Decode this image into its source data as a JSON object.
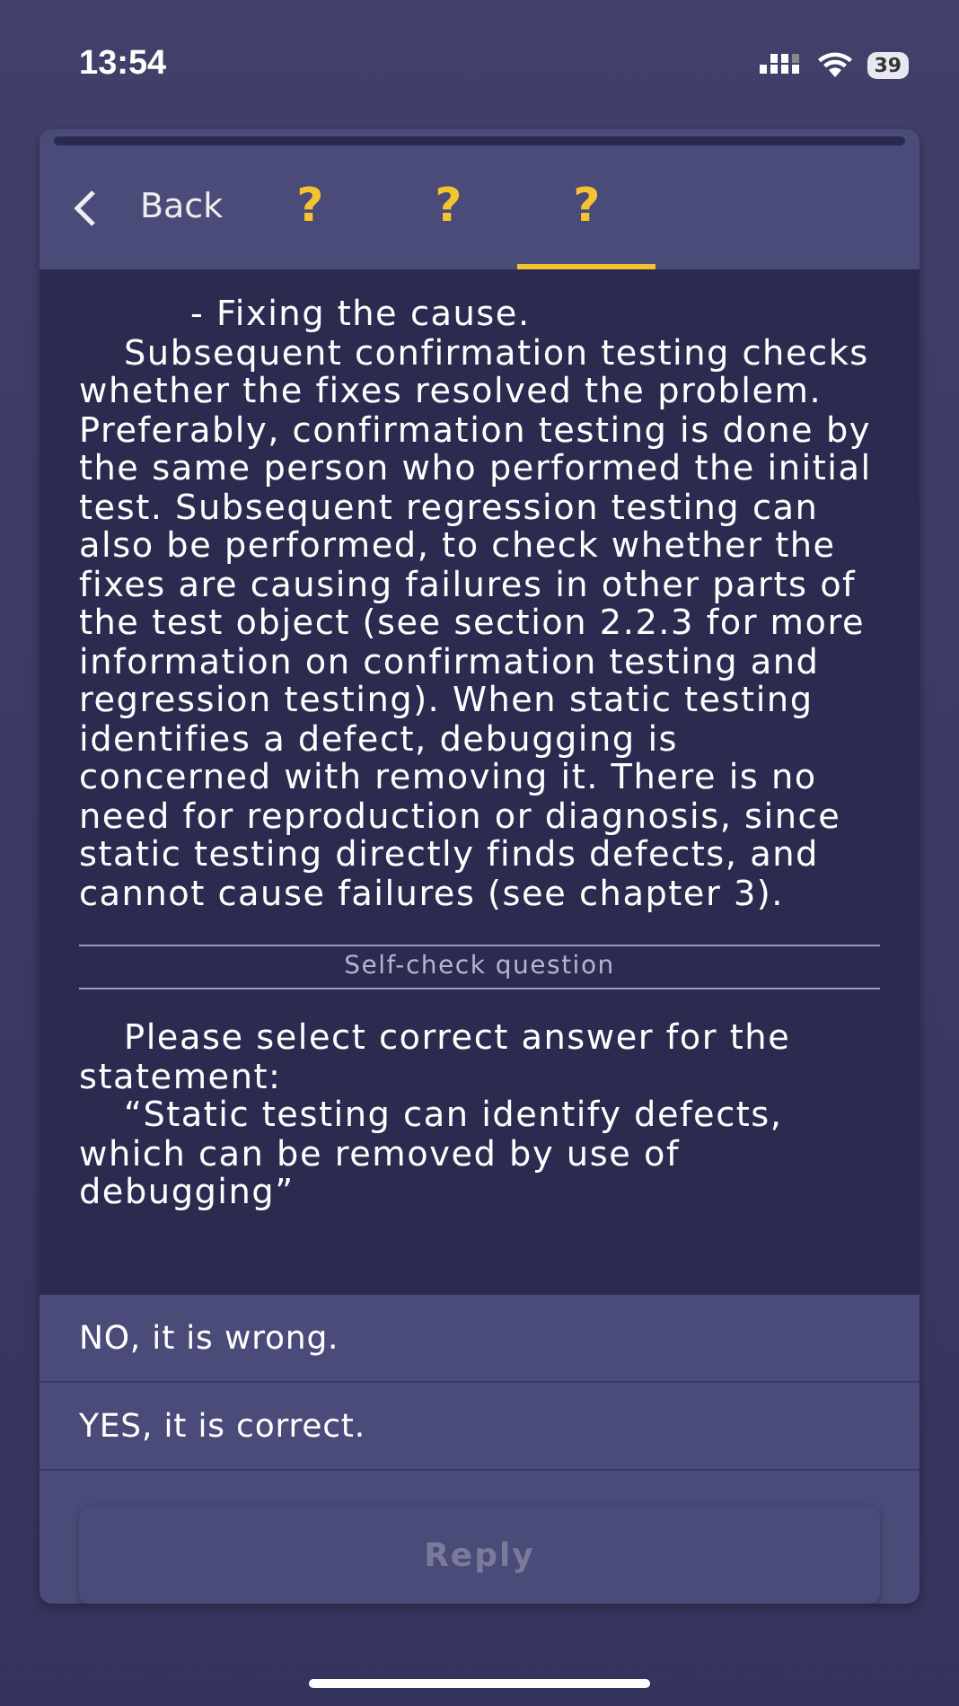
{
  "status_bar": {
    "time": "13:54",
    "battery": "39"
  },
  "header": {
    "back_label": "Back",
    "tabs": [
      {
        "label": "?",
        "selected": false
      },
      {
        "label": "?",
        "selected": false
      },
      {
        "label": "?",
        "selected": true
      }
    ]
  },
  "content": {
    "paragraphs": [
      {
        "text": "- Fixing the cause.",
        "kind": "bullet"
      },
      {
        "text": "Subsequent confirmation testing checks whether the fixes resolved the problem. Preferably, confirmation testing is done by the same person who performed the initial test. Subsequent regression testing can also be performed, to check whether the fixes are causing failures in other parts of the test object (see section 2.2.3 for more information on confirmation testing and regression testing). When static testing identifies a defect, debugging is concerned with removing it. There is no need for reproduction or diagnosis, since static testing directly finds defects, and cannot cause failures (see chapter 3).",
        "kind": "paragraph"
      }
    ],
    "section_title": "Self-check question",
    "question": [
      "Please select correct answer for the statement:",
      "“Static testing can identify defects, which can be removed by use of debugging”"
    ]
  },
  "answers": [
    {
      "text": "NO, it is wrong.",
      "selected": false
    },
    {
      "text": "YES, it is correct.",
      "selected": false
    }
  ],
  "reply_button": {
    "label": "Reply",
    "disabled": true
  }
}
